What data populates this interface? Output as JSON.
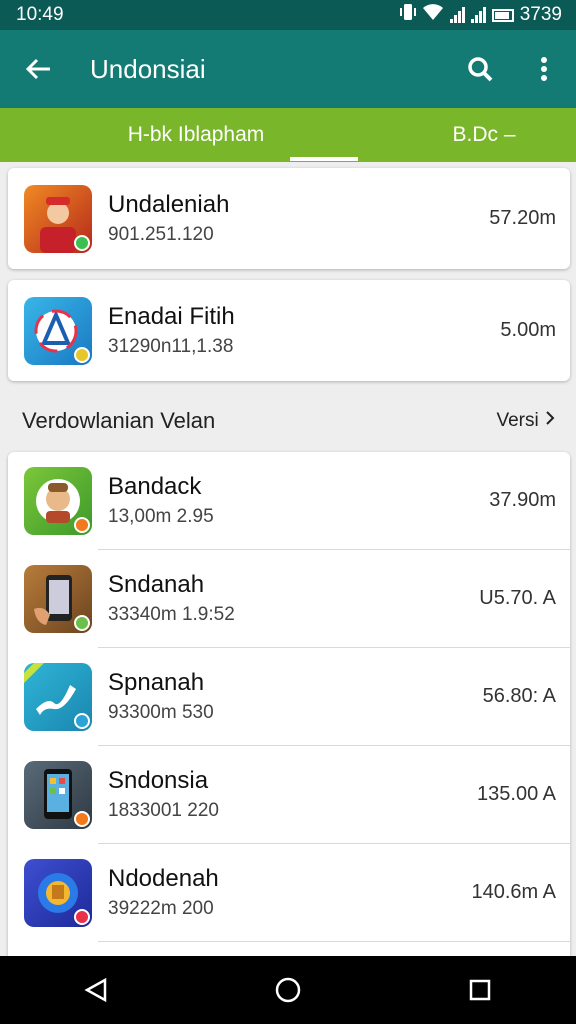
{
  "status": {
    "time": "10:49",
    "battery": "3739"
  },
  "appbar": {
    "title": "Undonsiai"
  },
  "tabs": [
    {
      "label": "H-bk Iblapham"
    },
    {
      "label": "B.Dc –"
    }
  ],
  "top_apps": [
    {
      "name": "Undaleniah",
      "sub": "901.251.120",
      "size": "57.20m",
      "icon": "person-in-red-icon",
      "colors": [
        "#f08a24",
        "#b5281b"
      ],
      "badge": "#3bbf4e"
    },
    {
      "name": "Enadai Fitih",
      "sub": "31290n11,1.38",
      "size": "5.00m",
      "icon": "compass-a-icon",
      "colors": [
        "#38b6e8",
        "#1a78c2"
      ],
      "badge": "#e6c62a"
    }
  ],
  "section": {
    "title": "Verdowlanian Velan",
    "link": "Versi",
    "link_icon": "chevron-right-icon"
  },
  "apps": [
    {
      "name": "Bandack",
      "sub": "13,00m 2.95",
      "size": "37.90m",
      "icon": "cartoon-face-icon",
      "colors": [
        "#7cc63a",
        "#3c9a2a"
      ],
      "badge": "#f07a1c"
    },
    {
      "name": "Sndanah",
      "sub": "33340m 1.9:52",
      "size": "U5.70. A",
      "icon": "phone-in-hand-icon",
      "colors": [
        "#b87c3a",
        "#6b4420"
      ],
      "badge": "#6cc04a"
    },
    {
      "name": "Spnanah",
      "sub": "93300m 530",
      "size": "56.80: A",
      "icon": "wave-check-icon",
      "colors": [
        "#2fb5d6",
        "#1a86b0"
      ],
      "badge": "#2aa4d8"
    },
    {
      "name": "Sndonsia",
      "sub": "1833001 220",
      "size": "135.00 A",
      "icon": "smartphone-icon",
      "colors": [
        "#596a78",
        "#2f3a44"
      ],
      "badge": "#f07a1c"
    },
    {
      "name": "Ndodenah",
      "sub": "39222m 200",
      "size": "140.6m A",
      "icon": "circle-emblem-icon",
      "colors": [
        "#3e4fd0",
        "#1e2a9a"
      ],
      "badge": "#e8324a"
    }
  ],
  "navbar": {
    "back": "back-triangle-icon",
    "home": "home-circle-icon",
    "recents": "recents-square-icon"
  }
}
